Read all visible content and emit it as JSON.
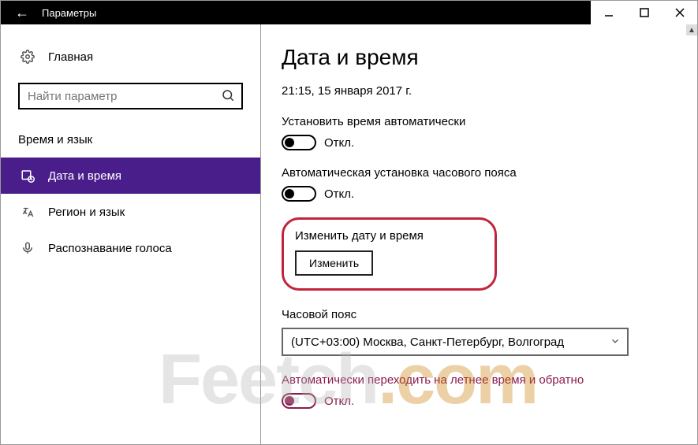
{
  "titlebar": {
    "title": "Параметры"
  },
  "sidebar": {
    "home": "Главная",
    "search_placeholder": "Найти параметр",
    "category": "Время и язык",
    "items": [
      {
        "label": "Дата и время"
      },
      {
        "label": "Регион и язык"
      },
      {
        "label": "Распознавание голоса"
      }
    ]
  },
  "content": {
    "heading": "Дата и время",
    "datetime": "21:15, 15 января 2017 г.",
    "auto_time": {
      "label": "Установить время автоматически",
      "state": "Откл."
    },
    "auto_tz": {
      "label": "Автоматическая установка часового пояса",
      "state": "Откл."
    },
    "change_dt": {
      "label": "Изменить дату и время",
      "button": "Изменить"
    },
    "timezone": {
      "label": "Часовой пояс",
      "value": "(UTC+03:00) Москва, Санкт-Петербург, Волгоград"
    },
    "dst": {
      "label": "Автоматически переходить на летнее время и обратно",
      "state": "Откл."
    }
  },
  "watermark": {
    "a": "Feetch",
    "b": ".com"
  }
}
